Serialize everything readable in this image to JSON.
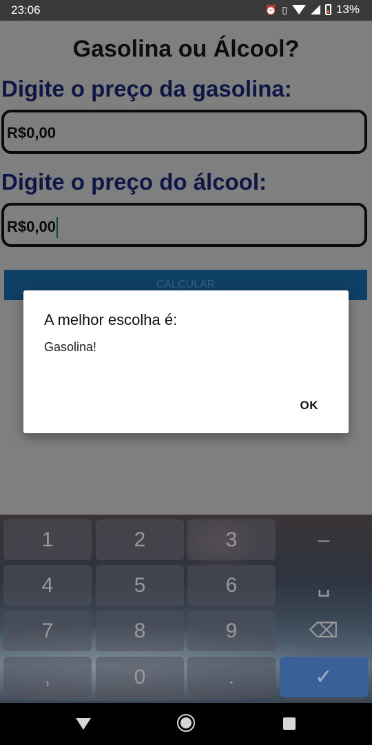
{
  "status_bar": {
    "time": "23:06",
    "battery_percent": "13%",
    "icons": [
      "alarm-icon",
      "vibrate-icon",
      "wifi-icon",
      "signal-icon",
      "battery-icon"
    ]
  },
  "app": {
    "title": "Gasolina ou Álcool?",
    "gas_label": "Digite o preço da gasolina:",
    "gas_value": "R$0,00",
    "alcohol_label": "Digite o preço do álcool:",
    "alcohol_value": "R$0,00",
    "calc_button": "CALCULAR"
  },
  "dialog": {
    "title": "A melhor escolha é:",
    "message": "Gasolina!",
    "ok_label": "OK"
  },
  "keyboard": {
    "keys": [
      "1",
      "2",
      "3",
      "–",
      "4",
      "5",
      "6",
      "␣",
      "7",
      "8",
      "9",
      "⌫",
      ",",
      "0",
      ".",
      "✓"
    ]
  },
  "colors": {
    "label_color": "#0e1646",
    "button_color": "#0e3f64",
    "enter_key": "#3b5f97"
  }
}
